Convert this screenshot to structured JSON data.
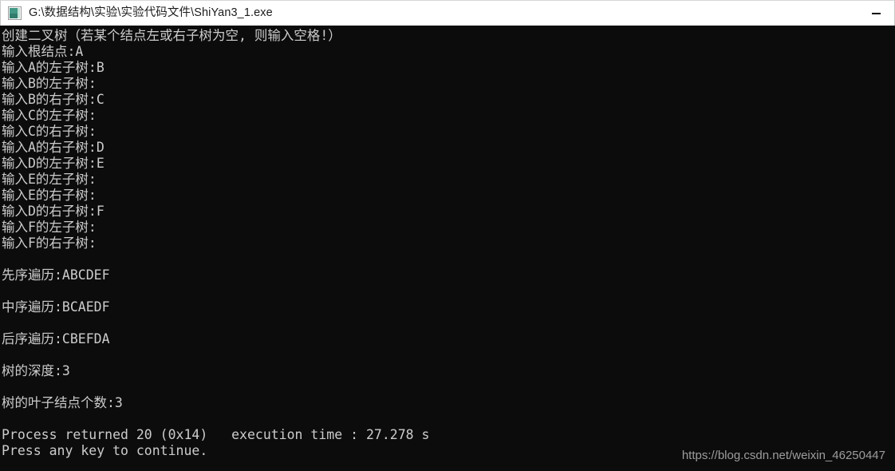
{
  "window": {
    "title": "G:\\数据结构\\实验\\实验代码文件\\ShiYan3_1.exe",
    "icon": "console-app-icon",
    "controls": {
      "minimize_label": "—"
    },
    "colors": {
      "titlebar_bg": "#ffffff",
      "titlebar_text": "#1c1c1c",
      "console_bg": "#0c0c0c",
      "console_text": "#cccccc",
      "watermark_text": "#9d9d9d"
    }
  },
  "console": {
    "lines": [
      "创建二叉树（若某个结点左或右子树为空, 则输入空格!）",
      "输入根结点:A",
      "输入A的左子树:B",
      "输入B的左子树:",
      "输入B的右子树:C",
      "输入C的左子树:",
      "输入C的右子树:",
      "输入A的右子树:D",
      "输入D的左子树:E",
      "输入E的左子树:",
      "输入E的右子树:",
      "输入D的右子树:F",
      "输入F的左子树:",
      "输入F的右子树:",
      "",
      "先序遍历:ABCDEF",
      "",
      "中序遍历:BCAEDF",
      "",
      "后序遍历:CBEFDA",
      "",
      "树的深度:3",
      "",
      "树的叶子结点个数:3",
      "",
      "Process returned 20 (0x14)   execution time : 27.278 s",
      "Press any key to continue."
    ],
    "results": {
      "preorder_label": "先序遍历",
      "preorder_value": "ABCDEF",
      "inorder_label": "中序遍历",
      "inorder_value": "BCAEDF",
      "postorder_label": "后序遍历",
      "postorder_value": "CBEFDA",
      "depth_label": "树的深度",
      "depth_value": "3",
      "leaf_count_label": "树的叶子结点个数",
      "leaf_count_value": "3",
      "return_code": "20",
      "return_code_hex": "0x14",
      "execution_time": "27.278 s"
    }
  },
  "watermark": {
    "text": "https://blog.csdn.net/weixin_46250447"
  }
}
